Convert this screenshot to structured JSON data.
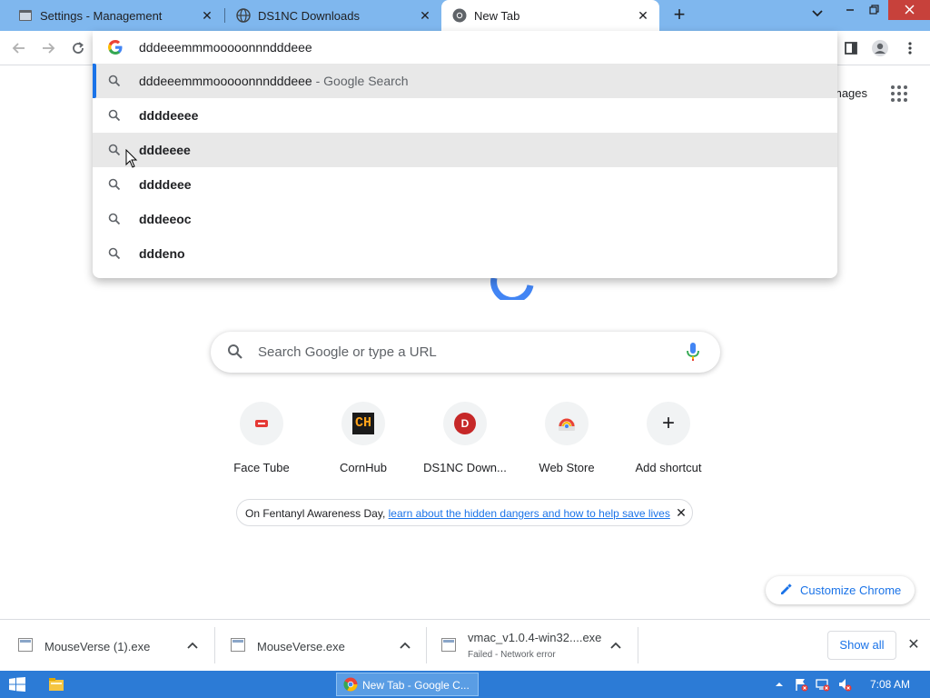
{
  "tabs": [
    {
      "title": "Settings - Management",
      "icon": "settings-favicon",
      "active": false
    },
    {
      "title": "DS1NC Downloads",
      "icon": "globe-favicon",
      "active": false
    },
    {
      "title": "New Tab",
      "icon": "chrome-favicon",
      "active": true
    }
  ],
  "omnibox": {
    "value": "dddeeemmmooooonnndddeee",
    "suggestions": [
      {
        "bold": "",
        "text": "dddeeemmmooooonnndddeee",
        "suffix": " - Google Search"
      },
      {
        "bold": "ddddeeee",
        "text": "",
        "suffix": ""
      },
      {
        "bold": "dddeeee",
        "text": "",
        "suffix": ""
      },
      {
        "bold": "ddddeee",
        "text": "",
        "suffix": ""
      },
      {
        "bold": "dddeeoc",
        "text": "",
        "suffix": ""
      },
      {
        "bold": "dddeno",
        "text": "",
        "suffix": ""
      }
    ]
  },
  "ntp": {
    "images_link": "mages",
    "search_placeholder": "Search Google or type a URL",
    "shortcuts": [
      {
        "label": "Face Tube",
        "icon": "facetube-icon"
      },
      {
        "label": "CornHub",
        "icon": "cornhub-icon",
        "glyph": "CH"
      },
      {
        "label": "DS1NC Down...",
        "icon": "ds1nc-icon",
        "glyph": "D"
      },
      {
        "label": "Web Store",
        "icon": "webstore-icon"
      },
      {
        "label": "Add shortcut",
        "icon": "plus-icon",
        "glyph": "+"
      }
    ],
    "promo": {
      "prefix": "On Fentanyl Awareness Day, ",
      "link": "learn about the hidden dangers and how to help save lives"
    },
    "customize_label": "Customize Chrome"
  },
  "downloads": [
    {
      "name": "MouseVerse (1).exe",
      "status": ""
    },
    {
      "name": "MouseVerse.exe",
      "status": ""
    },
    {
      "name": "vmac_v1.0.4-win32....exe",
      "status": "Failed - Network error"
    }
  ],
  "shelf": {
    "show_all": "Show all"
  },
  "taskbar": {
    "task_label": "New Tab - Google C...",
    "clock": "7:08 AM"
  },
  "colors": {
    "tabstrip": "#7fb7ee",
    "accent": "#1a73e8",
    "taskbar": "#2c7bd6"
  }
}
